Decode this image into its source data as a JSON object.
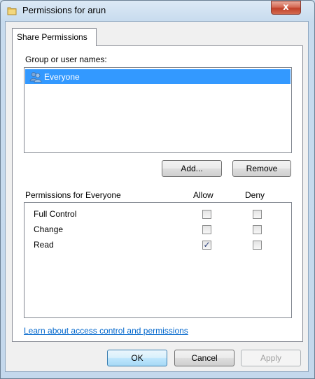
{
  "window": {
    "title": "Permissions for arun",
    "close_glyph": "x",
    "icon": "folder-icon"
  },
  "tabs": [
    {
      "label": "Share Permissions",
      "selected": true
    }
  ],
  "group_section": {
    "label": "Group or user names:",
    "items": [
      {
        "name": "Everyone",
        "icon": "users-icon",
        "selected": true
      }
    ],
    "add_label": "Add...",
    "remove_label": "Remove"
  },
  "permissions": {
    "label": "Permissions for Everyone",
    "allow_header": "Allow",
    "deny_header": "Deny",
    "rows": [
      {
        "name": "Full Control",
        "allow": false,
        "deny": false
      },
      {
        "name": "Change",
        "allow": false,
        "deny": false
      },
      {
        "name": "Read",
        "allow": true,
        "deny": false
      }
    ]
  },
  "help_link": "Learn about access control and permissions",
  "footer": {
    "ok_label": "OK",
    "cancel_label": "Cancel",
    "apply_label": "Apply",
    "apply_enabled": false
  },
  "colors": {
    "selection": "#3399ff",
    "link": "#0066cc",
    "check": "#2b3f7a"
  }
}
